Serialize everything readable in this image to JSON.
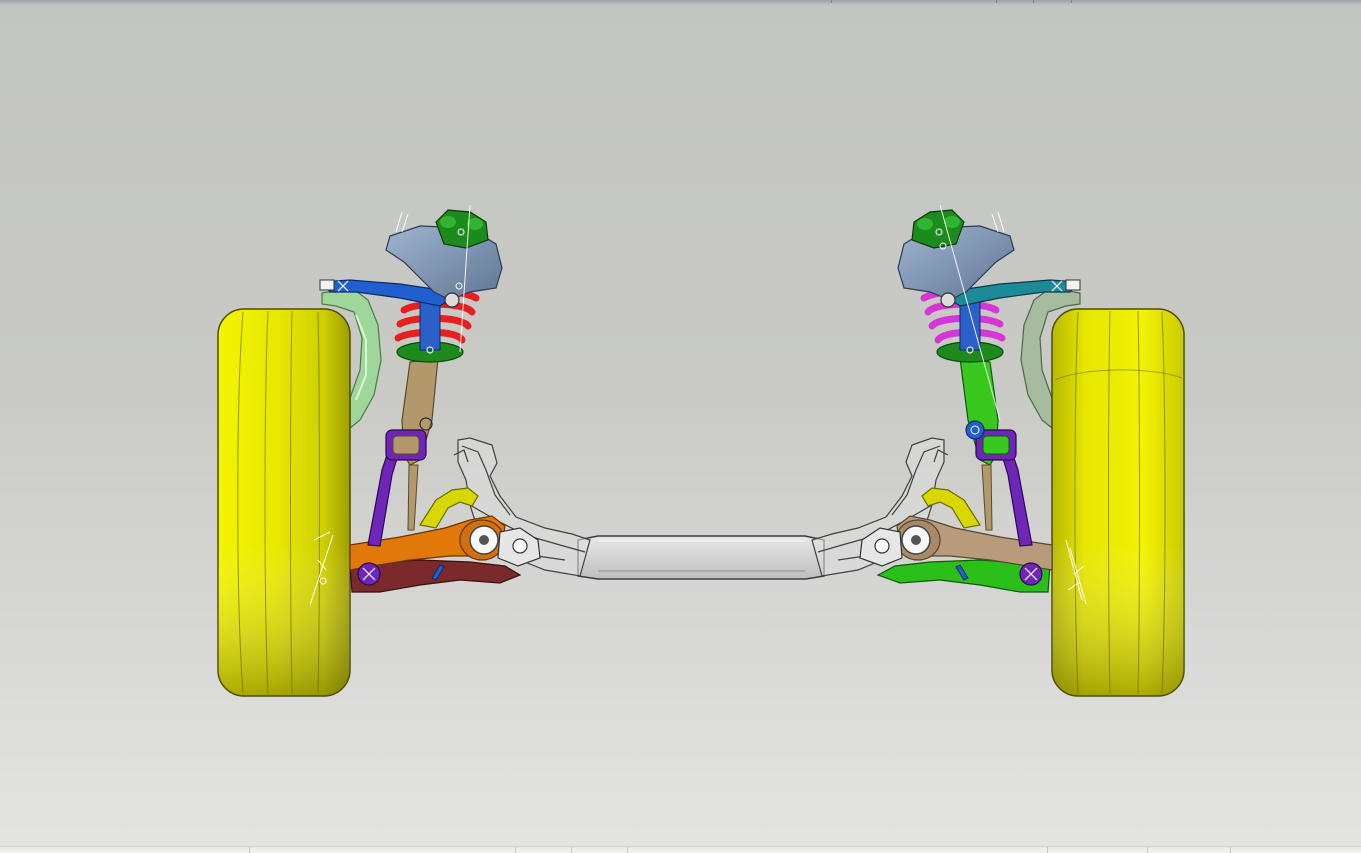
{
  "viewer": {
    "view_label": "",
    "model_name": ""
  },
  "scene": {
    "colors": {
      "tire": "#e6e600",
      "tire_shadow": "#9d9d00",
      "subframe": "#d2d3d2",
      "knuckle_left": "#9fd79a",
      "knuckle_right": "#a5bc9f",
      "spring_left": "#e81f1f",
      "spring_right": "#d835d8",
      "strut_left": "#b3986c",
      "strut_right": "#38c81e",
      "mount": "#768faf",
      "mount_cap": "#1d8a1d",
      "damper_bushing": "#6f25b8",
      "lower_arm_left": "#e0780a",
      "lower_arm_left_rear": "#7a2a2a",
      "lower_arm_right": "#b79b7a",
      "lower_arm_right_rear": "#2bbf1a",
      "upper_link_left": "#1f5fd0",
      "upper_link_right": "#1d8a9a",
      "stabilizer": "#d8d800"
    }
  }
}
